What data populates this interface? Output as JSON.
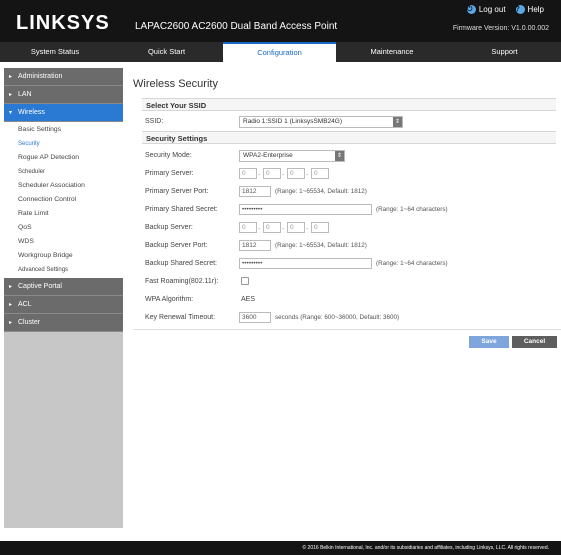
{
  "header": {
    "logo": "LINKSYS",
    "product": "LAPAC2600 AC2600 Dual Band Access Point",
    "logout": "Log out",
    "help": "Help",
    "firmware": "Firmware Version: V1.0.00.002"
  },
  "nav": {
    "tabs": [
      "System Status",
      "Quick Start",
      "Configuration",
      "Maintenance",
      "Support"
    ],
    "active": "Configuration"
  },
  "sidebar": {
    "administration": "Administration",
    "lan": "LAN",
    "wireless": "Wireless",
    "items": [
      "Basic Settings",
      "Security",
      "Rogue AP Detection",
      "Scheduler",
      "Scheduler Association",
      "Connection Control",
      "Rate Limit",
      "QoS",
      "WDS",
      "Workgroup Bridge",
      "Advanced Settings"
    ],
    "captive_portal": "Captive Portal",
    "acl": "ACL",
    "cluster": "Cluster"
  },
  "page": {
    "title": "Wireless Security",
    "select_ssid_heading": "Select Your SSID",
    "ssid_label": "SSID:",
    "ssid_value": "Radio 1:SSID 1 (LinksysSMB24G)",
    "security_heading": "Security Settings",
    "security_mode_label": "Security Mode:",
    "security_mode_value": "WPA2-Enterprise",
    "primary_server_label": "Primary Server:",
    "primary_server": [
      "0",
      "0",
      "0",
      "0"
    ],
    "primary_port_label": "Primary Server Port:",
    "primary_port_value": "1812",
    "primary_port_hint": "(Range: 1~65534, Default: 1812)",
    "primary_secret_label": "Primary Shared Secret:",
    "primary_secret_value": "•••••••••",
    "primary_secret_hint": "(Range: 1~64 characters)",
    "backup_server_label": "Backup Server:",
    "backup_server": [
      "0",
      "0",
      "0",
      "0"
    ],
    "backup_port_label": "Backup Server Port:",
    "backup_port_value": "1812",
    "backup_port_hint": "(Range: 1~65534, Default: 1812)",
    "backup_secret_label": "Backup Shared Secret:",
    "backup_secret_value": "•••••••••",
    "backup_secret_hint": "(Range: 1~64 characters)",
    "fast_roaming_label": "Fast Roaming(802.11r):",
    "fast_roaming_checked": false,
    "wpa_algorithm_label": "WPA Algorithm:",
    "wpa_algorithm_value": "AES",
    "key_renewal_label": "Key Renewal Timeout:",
    "key_renewal_value": "3600",
    "key_renewal_hint": "seconds (Range: 600~36000, Default: 3600)"
  },
  "buttons": {
    "save": "Save",
    "cancel": "Cancel"
  },
  "footer": {
    "text": "© 2016 Belkin International, Inc. and/or its subsidiaries and affiliates, including Linksys, LLC. All rights reserved."
  },
  "colors": {
    "accent": "#2a7ad3",
    "topbar": "#141414",
    "navbar": "#2a2a2a",
    "sidebar_header": "#6b6b6b",
    "save_button": "#7ea6dd",
    "cancel_button": "#5e5e5e"
  }
}
